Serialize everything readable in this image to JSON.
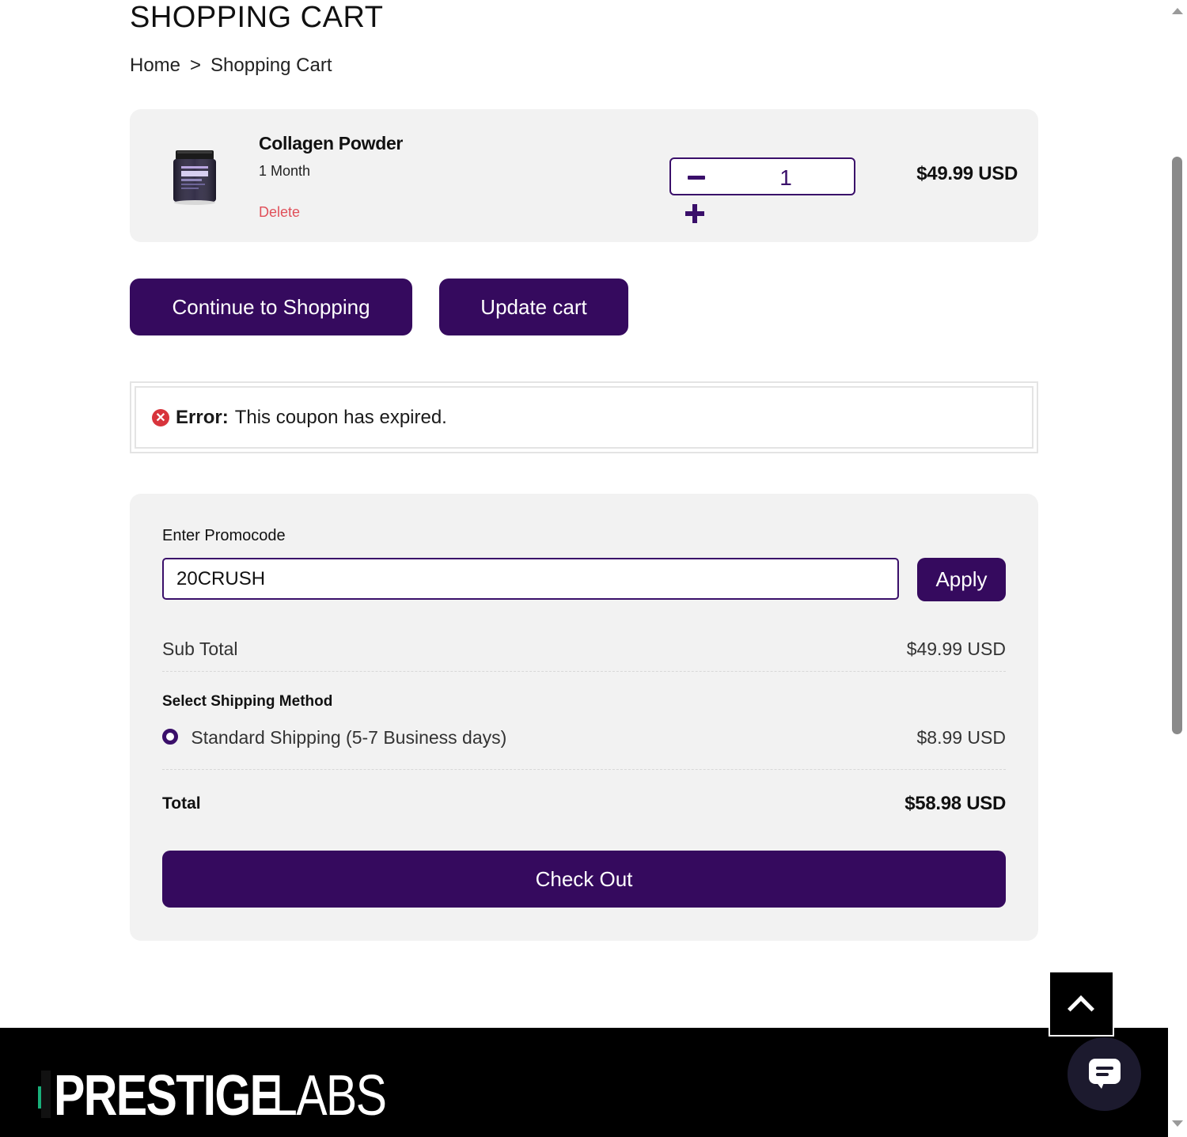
{
  "header": {
    "title": "SHOPPING CART",
    "breadcrumb": {
      "home": "Home",
      "separator": ">",
      "current": "Shopping Cart"
    }
  },
  "cart": {
    "items": [
      {
        "name": "Collagen Powder",
        "variant": "1 Month",
        "delete_label": "Delete",
        "quantity": "1",
        "price": "$49.99 USD",
        "image_icon": "collagen-jar-image"
      }
    ]
  },
  "actions": {
    "continue_label": "Continue to Shopping",
    "update_label": "Update cart"
  },
  "notice": {
    "label": "Error:",
    "message": "This coupon has expired."
  },
  "summary": {
    "promo_label": "Enter Promocode",
    "promo_value": "20CRUSH",
    "apply_label": "Apply",
    "subtotal_label": "Sub Total",
    "subtotal_value": "$49.99 USD",
    "shipping_heading": "Select Shipping Method",
    "shipping_option": "Standard Shipping (5-7 Business days)",
    "shipping_value": "$8.99 USD",
    "total_label": "Total",
    "total_value": "$58.98 USD",
    "checkout_label": "Check Out"
  },
  "footer": {
    "logo_bold": "PRESTIGE",
    "logo_light": "LABS"
  },
  "colors": {
    "brand_purple": "#350a5e",
    "error_red": "#d8343c",
    "delete_red": "#e0505a",
    "panel_gray": "#f2f2f2",
    "logo_green": "#19b07a"
  }
}
